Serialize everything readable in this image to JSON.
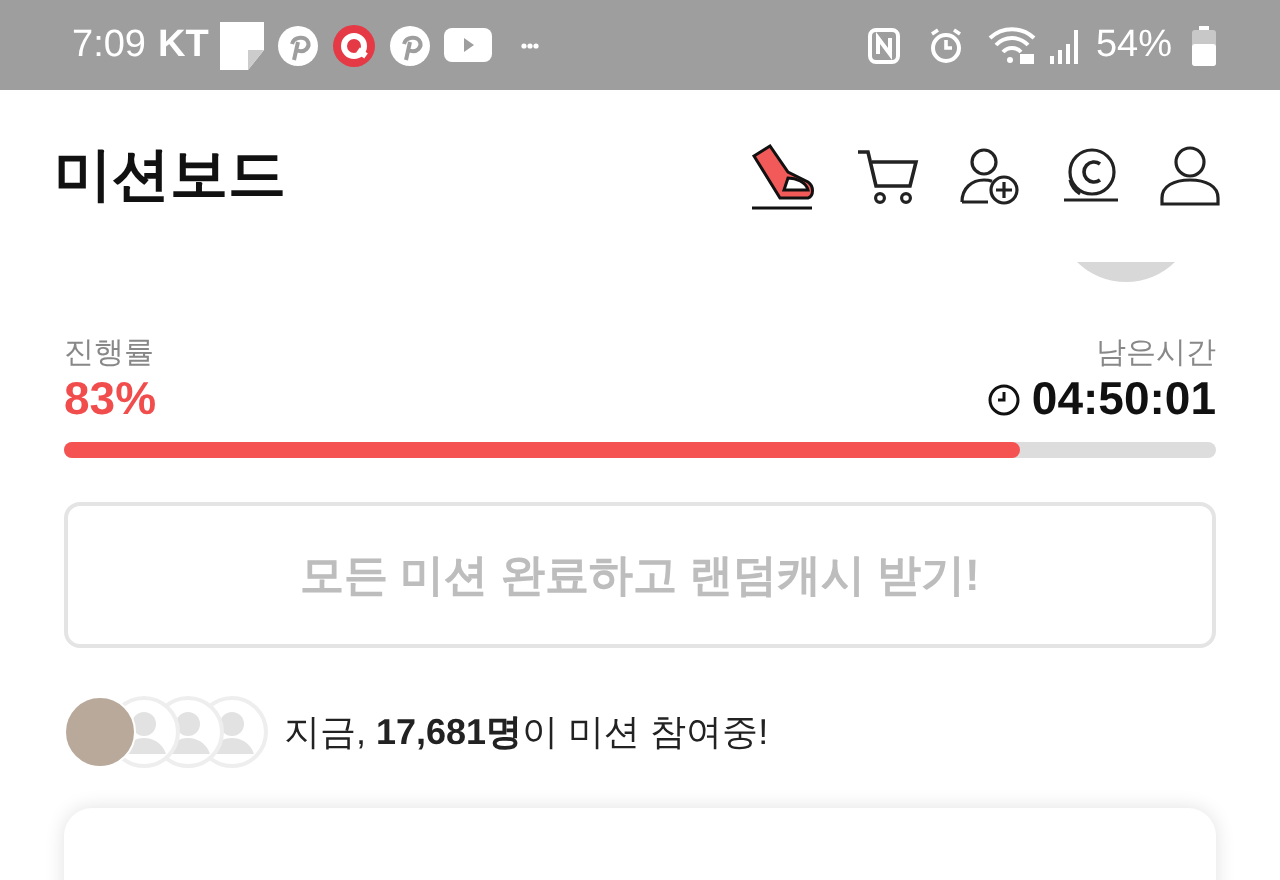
{
  "status_bar": {
    "time": "7:09",
    "carrier": "KT",
    "battery": "54%"
  },
  "header": {
    "title": "미션보드"
  },
  "progress": {
    "label": "진행률",
    "percent": "83%",
    "level": 0.83,
    "remaining_label": "남은시간",
    "remaining_time": "04:50:01"
  },
  "complete_button": {
    "label": "모든 미션 완료하고 랜덤캐시 받기!",
    "disabled": true
  },
  "participants": {
    "text": "지금, **17,681명**이 미션 참여중!"
  }
}
